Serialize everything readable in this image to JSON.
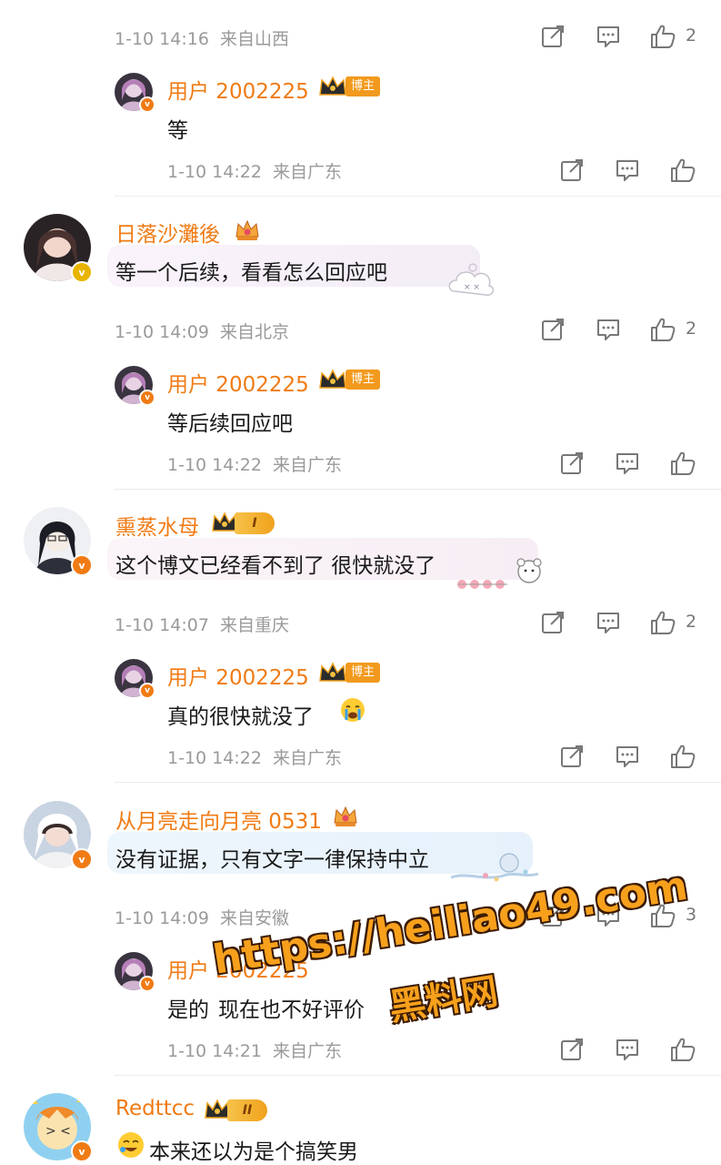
{
  "colors": {
    "username": "#f07b14",
    "meta": "#9a9a9a",
    "badge_orange": "#f07b14",
    "badge_gold": "#e9b400"
  },
  "threads": [
    {
      "top_partial": {
        "meta_time": "1-10 14:16",
        "meta_loc": "来自山西",
        "likes": "2"
      },
      "reply": {
        "user": "用户 2002225",
        "badge": "博主",
        "text": "等",
        "meta_time": "1-10 14:22",
        "meta_loc": "来自广东"
      }
    },
    {
      "comment": {
        "user": "日落沙灘後",
        "text": "等一个后续，看看怎么回应吧",
        "meta_time": "1-10 14:09",
        "meta_loc": "来自北京",
        "likes": "2"
      },
      "reply": {
        "user": "用户 2002225",
        "badge": "博主",
        "text": "等后续回应吧",
        "meta_time": "1-10 14:22",
        "meta_loc": "来自广东"
      }
    },
    {
      "comment": {
        "user": "熏蒸水母",
        "rank": "I",
        "text": "这个博文已经看不到了 很快就没了",
        "meta_time": "1-10 14:07",
        "meta_loc": "来自重庆",
        "likes": "2"
      },
      "reply": {
        "user": "用户 2002225",
        "badge": "博主",
        "text": "真的很快就没了",
        "emoji": "crying-emoji",
        "meta_time": "1-10 14:22",
        "meta_loc": "来自广东"
      }
    },
    {
      "comment": {
        "user": "从月亮走向月亮 0531",
        "text": "没有证据，只有文字一律保持中立",
        "meta_time": "1-10 14:09",
        "meta_loc": "来自安徽",
        "likes": "3"
      },
      "reply": {
        "user": "用户 2002225",
        "text_visible": "是的",
        "text_after": "现在也不好评价",
        "meta_time": "1-10 14:21",
        "meta_loc": "来自广东"
      }
    },
    {
      "comment": {
        "user": "Redttcc",
        "rank": "II",
        "text": "本来还以为是个搞笑男",
        "emoji": "laughing-emoji"
      }
    }
  ],
  "watermark": {
    "url": "https://heiliao49.com",
    "name": "黑料网"
  }
}
